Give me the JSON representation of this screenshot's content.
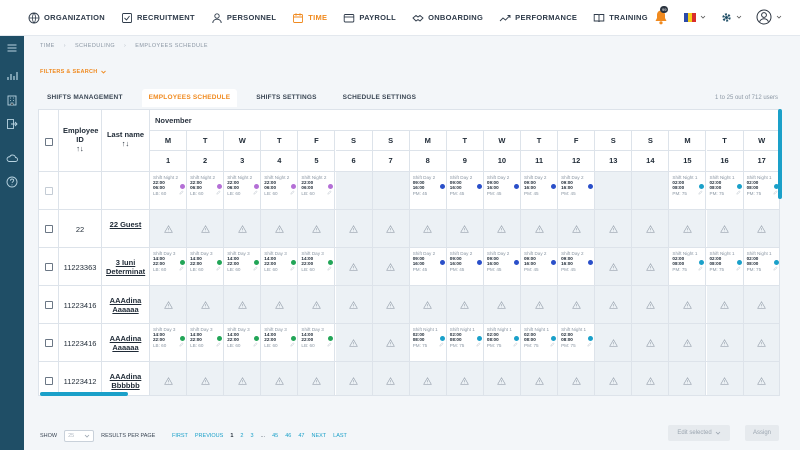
{
  "nav": {
    "items": [
      {
        "label": "Organization",
        "icon": "globe-icon",
        "active": false
      },
      {
        "label": "Recruitment",
        "icon": "checklist-icon",
        "active": false
      },
      {
        "label": "Personnel",
        "icon": "person-icon",
        "active": false
      },
      {
        "label": "Time",
        "icon": "calendar-icon",
        "active": true
      },
      {
        "label": "Payroll",
        "icon": "wallet-icon",
        "active": false
      },
      {
        "label": "Onboarding",
        "icon": "handshake-icon",
        "active": false
      },
      {
        "label": "Performance",
        "icon": "trend-icon",
        "active": false
      },
      {
        "label": "Training",
        "icon": "book-icon",
        "active": false
      }
    ],
    "notification_count": "99",
    "flag_colors": [
      "#2b4aa8",
      "#f4cf1b",
      "#d92c2c"
    ]
  },
  "sidebar_icons": [
    "menu-icon",
    "chart-icon",
    "building-icon",
    "exit-icon",
    "cloud-icon",
    "help-icon"
  ],
  "breadcrumb": [
    "Time",
    "Scheduling",
    "Employees schedule"
  ],
  "filters_label": "Filters & search",
  "tabs": [
    {
      "label": "Shifts management",
      "active": false
    },
    {
      "label": "Employees schedule",
      "active": true
    },
    {
      "label": "Shifts settings",
      "active": false
    },
    {
      "label": "Schedule settings",
      "active": false
    }
  ],
  "results_count": "1 to 25 out of 712 users",
  "grid": {
    "col_employee_id": "Employee ID",
    "col_last_name": "Last name",
    "month": "November",
    "days": [
      {
        "dow": "M",
        "num": "1"
      },
      {
        "dow": "T",
        "num": "2"
      },
      {
        "dow": "W",
        "num": "3"
      },
      {
        "dow": "T",
        "num": "4"
      },
      {
        "dow": "F",
        "num": "5"
      },
      {
        "dow": "S",
        "num": "6"
      },
      {
        "dow": "S",
        "num": "7"
      },
      {
        "dow": "M",
        "num": "8"
      },
      {
        "dow": "T",
        "num": "9"
      },
      {
        "dow": "W",
        "num": "10"
      },
      {
        "dow": "T",
        "num": "11"
      },
      {
        "dow": "F",
        "num": "12"
      },
      {
        "dow": "S",
        "num": "13"
      },
      {
        "dow": "S",
        "num": "14"
      },
      {
        "dow": "M",
        "num": "15"
      },
      {
        "dow": "T",
        "num": "16"
      },
      {
        "dow": "W",
        "num": "17"
      }
    ],
    "shift_types": {
      "n2": {
        "name": "Shift Night 2",
        "t1": "22:00",
        "t2": "06:00",
        "foot": "LB: 60",
        "color": "#b46fd6"
      },
      "d2": {
        "name": "Shift Day 2",
        "t1": "09:00",
        "t2": "16:00",
        "foot": "PM: 45",
        "color": "#2a4fc9"
      },
      "n1": {
        "name": "Shift Night 1",
        "t1": "02:00",
        "t2": "08:00",
        "foot": "PM: 75",
        "color": "#1aa0c9"
      },
      "d3": {
        "name": "Shift Day 3",
        "t1": "14:00",
        "t2": "22:00",
        "foot": "LB: 60",
        "color": "#22a557"
      }
    },
    "rows": [
      {
        "id": "",
        "name": "",
        "cells": [
          "n2",
          "n2",
          "n2",
          "n2",
          "n2",
          "",
          "",
          "d2",
          "d2",
          "d2",
          "d2",
          "d2",
          "",
          "",
          "n1",
          "n1",
          "n1"
        ]
      },
      {
        "id": "22",
        "name": "22 Guest",
        "cells": [
          "x",
          "x",
          "x",
          "x",
          "x",
          "x",
          "x",
          "x",
          "x",
          "x",
          "x",
          "x",
          "x",
          "x",
          "x",
          "x",
          "x"
        ]
      },
      {
        "id": "11223363",
        "name": "3 Iuni Determinat",
        "cells": [
          "d3",
          "d3",
          "d3",
          "d3",
          "d3",
          "x",
          "x",
          "d2",
          "d2",
          "d2",
          "d2",
          "d2",
          "x",
          "x",
          "n1",
          "n1",
          "n1"
        ]
      },
      {
        "id": "11223416",
        "name": "AAAdina Aaaaaa",
        "cells": [
          "x",
          "x",
          "x",
          "x",
          "x",
          "x",
          "x",
          "x",
          "x",
          "x",
          "x",
          "x",
          "x",
          "x",
          "x",
          "x",
          "x"
        ]
      },
      {
        "id": "11223416",
        "name": "AAAdina Aaaaaa",
        "cells": [
          "d3",
          "d3",
          "d3",
          "d3",
          "d3",
          "x",
          "x",
          "n1",
          "n1",
          "n1",
          "n1",
          "n1",
          "x",
          "x",
          "x",
          "x",
          "x"
        ]
      },
      {
        "id": "11223412",
        "name": "AAAdina Bbbbbb",
        "cells": [
          "x",
          "x",
          "x",
          "x",
          "x",
          "x",
          "x",
          "x",
          "x",
          "x",
          "x",
          "x",
          "x",
          "x",
          "x",
          "x",
          "x"
        ]
      }
    ]
  },
  "footer": {
    "show_label": "Show",
    "per_page": "25",
    "results_label": "Results per page",
    "pager": [
      "First",
      "Previous",
      "1",
      "2",
      "3",
      "...",
      "45",
      "46",
      "47",
      "Next",
      "Last"
    ],
    "current_page": "1",
    "edit_label": "Edit selected",
    "assign_label": "Assign"
  }
}
